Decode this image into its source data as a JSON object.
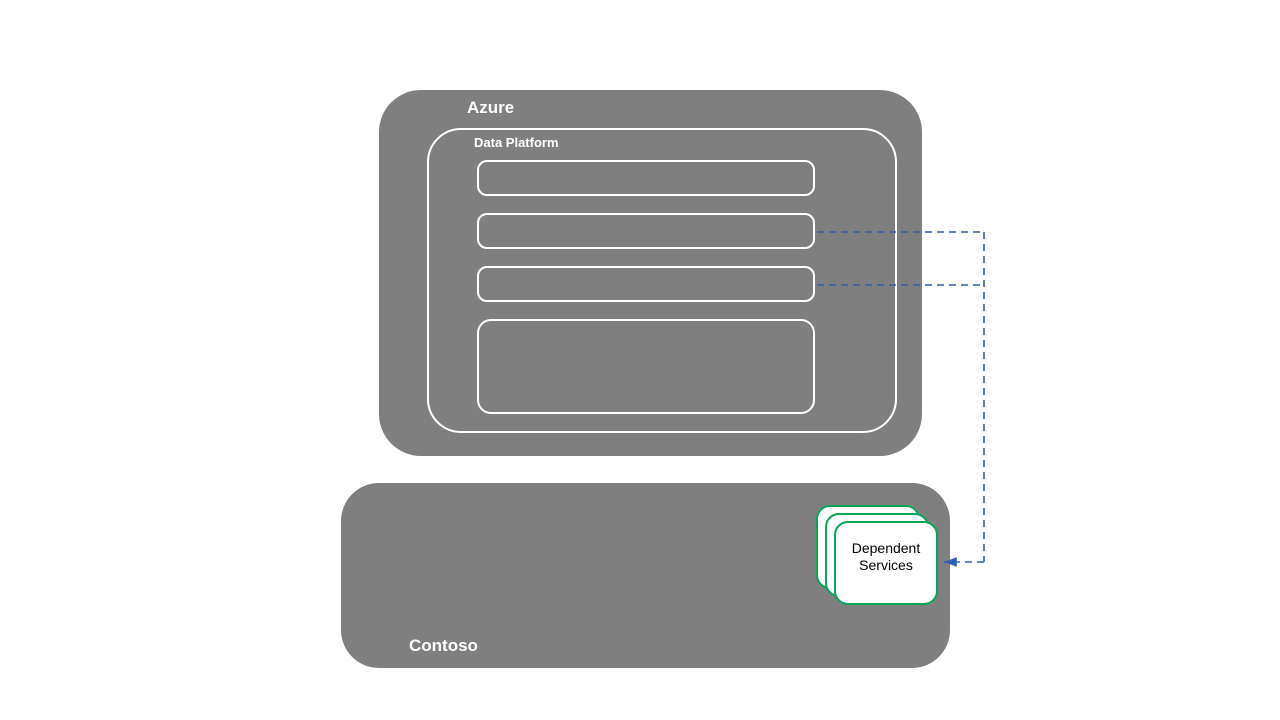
{
  "azure": {
    "label": "Azure",
    "data_platform": {
      "label": "Data Platform",
      "slots": [
        "",
        "",
        ""
      ],
      "big_slot": ""
    }
  },
  "contoso": {
    "label": "Contoso",
    "dependent_services": {
      "line1": "Dependent",
      "line2": "Services"
    }
  },
  "connectors": {
    "style": "dashed",
    "color": "#2e5fb3",
    "from": [
      "data-platform-slot-2",
      "data-platform-slot-3"
    ],
    "to": "dependent-services-card",
    "arrow_at_target": true
  }
}
